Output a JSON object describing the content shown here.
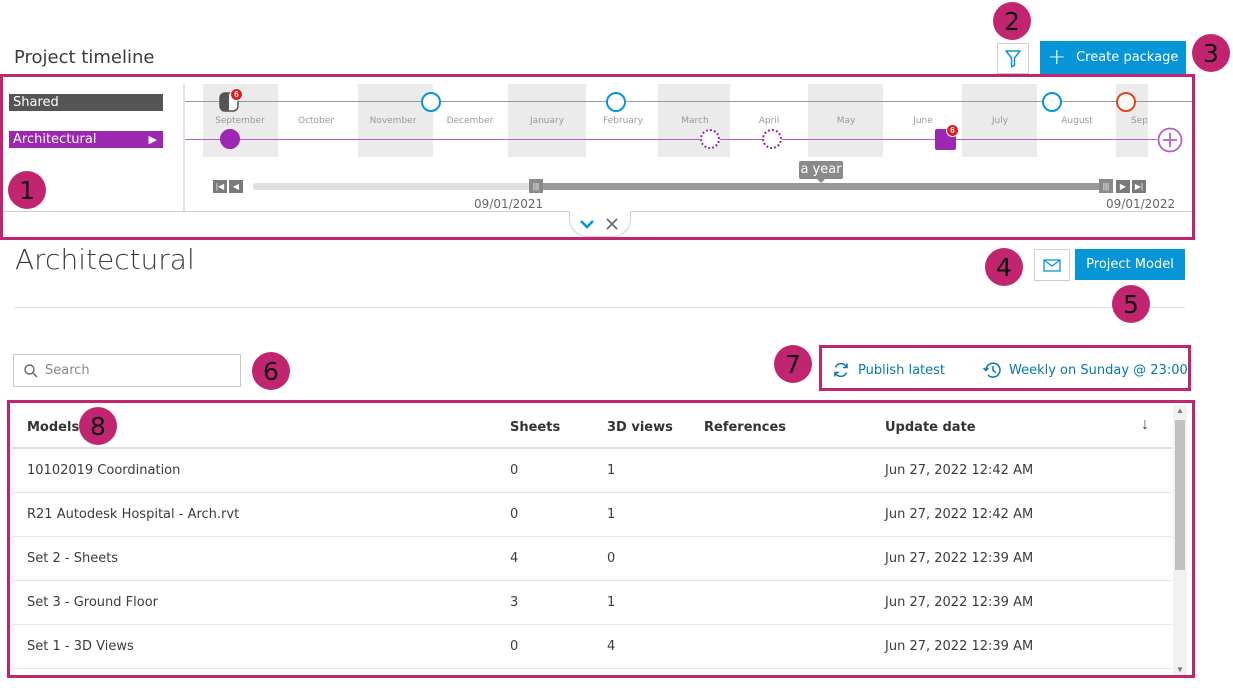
{
  "header": {
    "title": "Project timeline",
    "create_label": "Create package"
  },
  "lanes": {
    "shared": "Shared",
    "architectural": "Architectural",
    "arch_arrow": "▶"
  },
  "months": [
    "September",
    "October",
    "November",
    "December",
    "January",
    "February",
    "March",
    "April",
    "May",
    "June",
    "July",
    "August",
    "Sep"
  ],
  "badges": {
    "shared_badge": "6",
    "arch_badge": "6"
  },
  "scrubber": {
    "duration": "a year",
    "start_date": "09/01/2021",
    "end_date": "09/01/2022"
  },
  "section": {
    "title": "Architectural",
    "project_model_label": "Project Model"
  },
  "search": {
    "placeholder": "Search"
  },
  "publish": {
    "latest_label": "Publish latest",
    "schedule_label": "Weekly on Sunday @ 23:00"
  },
  "table": {
    "columns": {
      "models": "Models",
      "sheets": "Sheets",
      "views3d": "3D views",
      "references": "References",
      "update_date": "Update date",
      "sort_icon": "↓"
    },
    "rows": [
      {
        "name": "10102019 Coordination",
        "sheets": "0",
        "views": "1",
        "date": "Jun 27, 2022 12:42 AM"
      },
      {
        "name": "R21 Autodesk Hospital - Arch.rvt",
        "sheets": "0",
        "views": "1",
        "date": "Jun 27, 2022 12:42 AM"
      },
      {
        "name": "Set 2 - Sheets",
        "sheets": "4",
        "views": "0",
        "date": "Jun 27, 2022 12:39 AM"
      },
      {
        "name": "Set 3 - Ground Floor",
        "sheets": "3",
        "views": "1",
        "date": "Jun 27, 2022 12:39 AM"
      },
      {
        "name": "Set 1 - 3D Views",
        "sheets": "0",
        "views": "4",
        "date": "Jun 27, 2022 12:39 AM"
      }
    ]
  },
  "callouts": [
    "1",
    "2",
    "3",
    "4",
    "5",
    "6",
    "7",
    "8"
  ],
  "colors": {
    "accent": "#0696d7",
    "callout": "#c2256f",
    "arch": "#9c27b0",
    "shared": "#555555"
  }
}
